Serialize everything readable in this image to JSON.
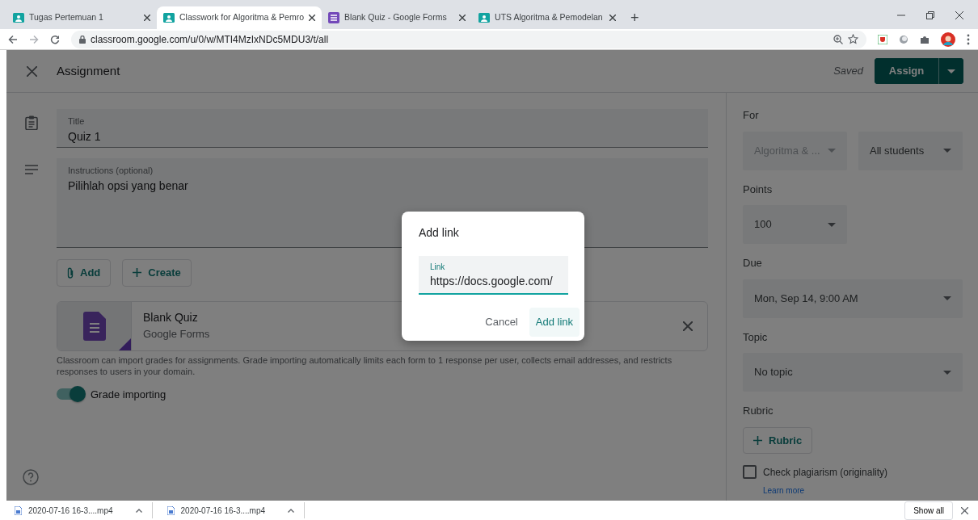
{
  "browser": {
    "tabs": [
      {
        "title": "Tugas Pertemuan 1",
        "kind": "classroom",
        "selected": false
      },
      {
        "title": "Classwork for Algoritma & Pemro",
        "kind": "classroom",
        "selected": true
      },
      {
        "title": "Blank Quiz - Google Forms",
        "kind": "forms",
        "selected": false
      },
      {
        "title": "UTS Algoritma & Pemodelan",
        "kind": "classroom",
        "selected": false
      }
    ],
    "new_tab": "+",
    "address": "classroom.google.com/u/0/w/MTI4MzIxNDc5MDU3/t/all"
  },
  "header": {
    "title": "Assignment",
    "status": "Saved",
    "assign_button": "Assign"
  },
  "form": {
    "title": {
      "label": "Title",
      "value": "Quiz 1"
    },
    "instructions": {
      "label": "Instructions (optional)",
      "value": "Pilihlah opsi yang benar"
    },
    "buttons": [
      {
        "label": "Add",
        "kind": "attach"
      },
      {
        "label": "Create",
        "kind": "plus"
      }
    ],
    "attachment": {
      "title": "Blank Quiz",
      "subtitle": "Google Forms"
    },
    "note": "Classroom can import grades for assignments. Grade importing automatically limits each form to 1 response per user, collects email addresses, and restricts responses to users in your domain.",
    "toggle": {
      "label": "Grade importing",
      "on": true
    }
  },
  "sidebar": {
    "for": {
      "label": "For",
      "class": {
        "value": "Algoritma & ...",
        "disabled": true
      },
      "students": {
        "value": "All students",
        "disabled": false
      }
    },
    "points": {
      "label": "Points",
      "value": "100"
    },
    "due": {
      "label": "Due",
      "value": "Mon, Sep 14, 9:00 AM"
    },
    "topic": {
      "label": "Topic",
      "value": "No topic"
    },
    "rubric": {
      "label": "Rubric",
      "button": "Rubric"
    },
    "plagiarism": {
      "label": "Check plagiarism (originality)",
      "checked": false,
      "link": "Learn more"
    }
  },
  "dialog": {
    "title": "Add link",
    "field": {
      "label": "Link",
      "value": "https://docs.google.com/"
    },
    "cancel": "Cancel",
    "confirm": "Add link"
  },
  "downloads": {
    "items": [
      {
        "name": "2020-07-16 16-3....mp4"
      },
      {
        "name": "2020-07-16 16-3....mp4"
      }
    ],
    "show_all": "Show all"
  }
}
